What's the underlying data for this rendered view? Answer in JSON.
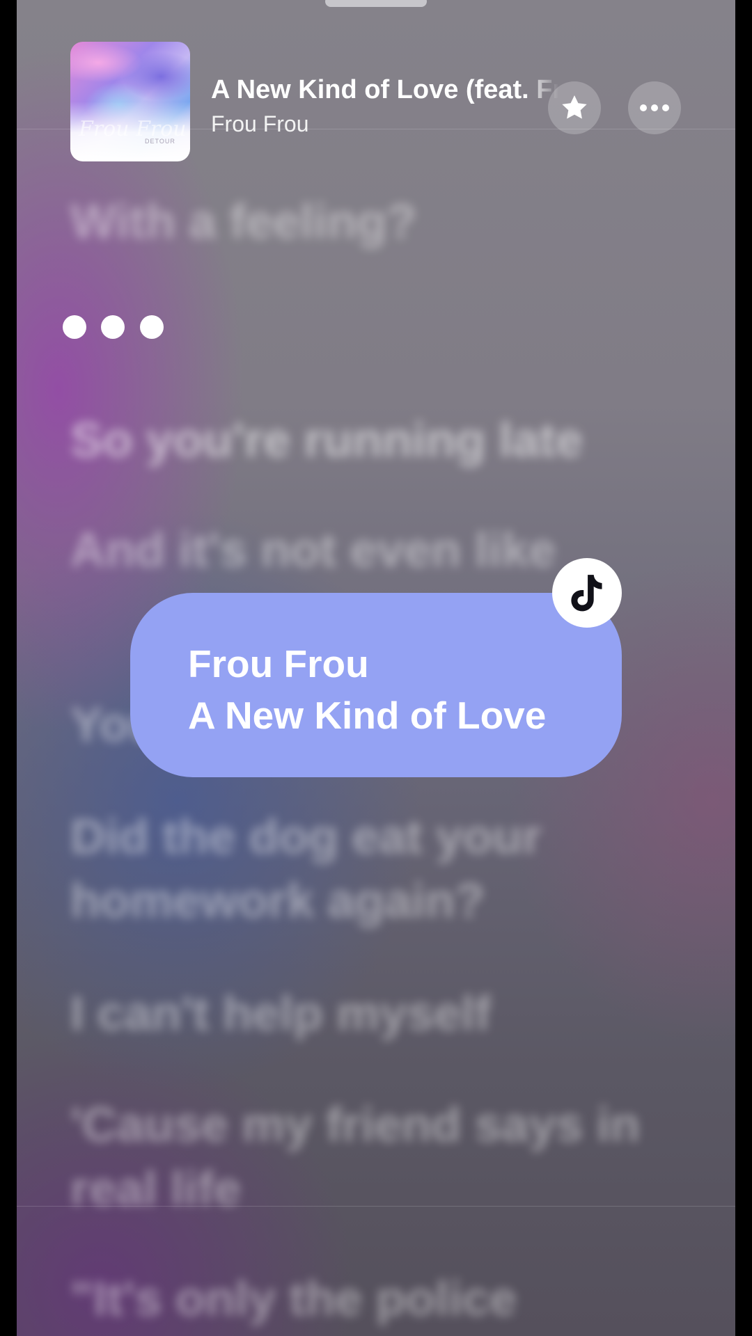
{
  "now_playing": {
    "title": "A New Kind of Love (feat. Frou Frou)",
    "artist": "Frou Frou",
    "artwork_text": "Frou Frou",
    "artwork_subtext": "DETOUR"
  },
  "buttons": {
    "favorite_icon": "star-icon",
    "more_icon": "ellipsis-icon"
  },
  "lyrics": [
    "With a feeling?",
    "So you're running late",
    "And it's not even like",
    "You",
    "Did the dog eat your homework again?",
    "I can't help myself",
    "'Cause my friend says in real life",
    "\"It's only the police"
  ],
  "instrumental_indicator": "three-dots",
  "share_card": {
    "artist": "Frou Frou",
    "title": "A New Kind of Love",
    "badge_icon": "tiktok-icon"
  },
  "colors": {
    "card_background": "#94a2f3",
    "text_primary": "#ffffff"
  }
}
